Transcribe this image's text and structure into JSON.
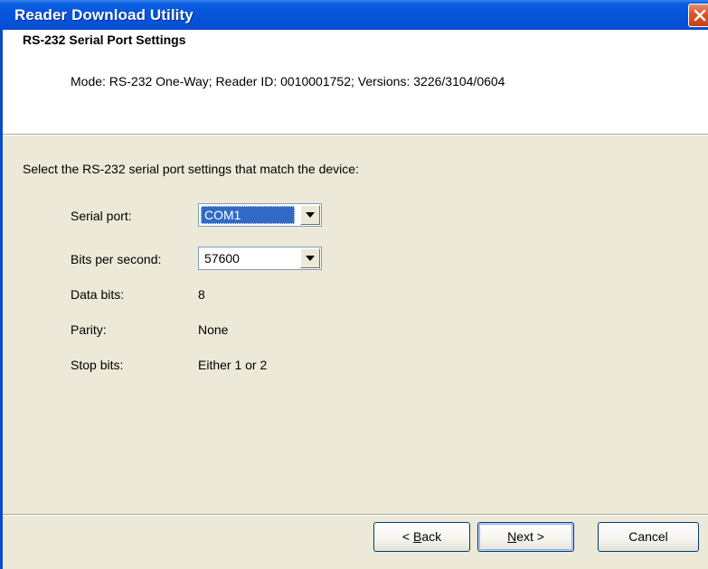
{
  "window": {
    "title": "Reader Download Utility"
  },
  "header": {
    "title": "RS-232 Serial Port Settings",
    "subtitle": "Mode: RS-232 One-Way; Reader ID: 0010001752; Versions: 3226/3104/0604"
  },
  "body": {
    "instruction": "Select the RS-232 serial port settings that match the device:",
    "fields": {
      "serial_port": {
        "label": "Serial port:",
        "value": "COM1"
      },
      "bits_per_second": {
        "label": "Bits per second:",
        "value": "57600"
      },
      "data_bits": {
        "label": "Data bits:",
        "value": "8"
      },
      "parity": {
        "label": "Parity:",
        "value": "None"
      },
      "stop_bits": {
        "label": "Stop bits:",
        "value": "Either 1 or 2"
      }
    }
  },
  "buttons": {
    "back": {
      "prefix": "< ",
      "mnemonic": "B",
      "rest": "ack"
    },
    "next": {
      "mnemonic": "N",
      "rest": "ext >"
    },
    "cancel": {
      "label": "Cancel"
    }
  },
  "icons": {
    "close": "close-icon",
    "dropdown": "chevron-down-icon"
  },
  "colors": {
    "titlebar": "#0655dc",
    "close_button": "#d9532a",
    "dialog_bg": "#ece9d8",
    "selection": "#316ac5",
    "button_border": "#003c74"
  }
}
